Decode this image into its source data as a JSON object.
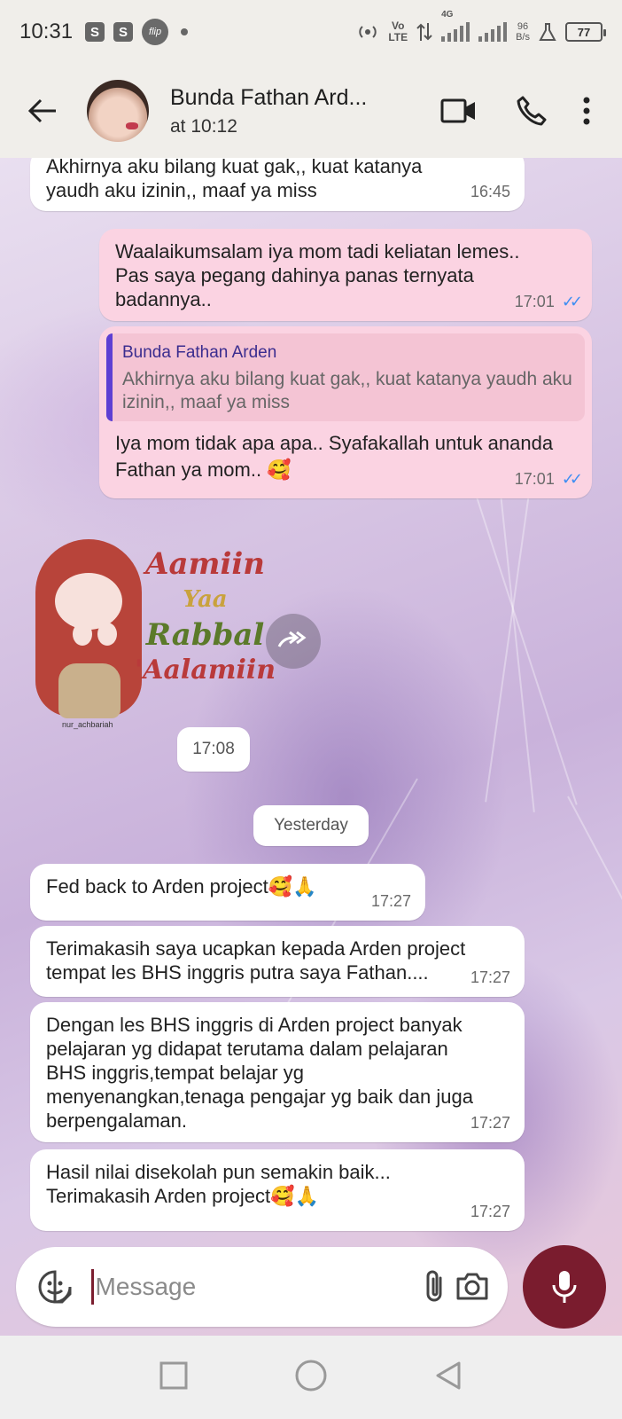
{
  "status_bar": {
    "time": "10:31",
    "flip_label": "flip",
    "network_top": "Vo",
    "network_bottom": "LTE",
    "network_gen": "4G",
    "speed_value": "96",
    "speed_unit": "B/s",
    "battery": "77"
  },
  "header": {
    "contact_name": "Bunda Fathan Ard...",
    "last_seen": "at 10:12"
  },
  "messages": {
    "m1": {
      "text": "Akhirnya aku bilang kuat gak,, kuat katanya yaudh aku izinin,, maaf ya miss",
      "time": "16:45"
    },
    "m2": {
      "text": "Waalaikumsalam iya mom tadi keliatan lemes.. Pas saya pegang dahinya panas ternyata badannya..",
      "time": "17:01"
    },
    "m3": {
      "quote_name": "Bunda Fathan Arden",
      "quote_text": "Akhirnya aku bilang kuat gak,, kuat katanya yaudh aku izinin,, maaf ya miss",
      "text": "Iya mom tidak apa apa.. Syafakallah untuk ananda Fathan ya mom.. 🥰",
      "time": "17:01"
    },
    "sticker": {
      "line1": "Aamiin",
      "line2": "Yaa",
      "line3": "Rabbal",
      "line4": "'Aalamiin",
      "credit": "nur_achbariah",
      "time": "17:08"
    },
    "date_divider": "Yesterday",
    "m4": {
      "text": "Fed back to Arden project🥰🙏",
      "time": "17:27"
    },
    "m5": {
      "text": "Terimakasih saya ucapkan kepada Arden project tempat les BHS inggris putra saya Fathan....",
      "time": "17:27"
    },
    "m6": {
      "text": "Dengan les BHS inggris di Arden project banyak pelajaran yg didapat terutama dalam pelajaran BHS inggris,tempat belajar yg menyenangkan,tenaga pengajar yg baik dan juga berpengalaman.",
      "time": "17:27"
    },
    "m7": {
      "text": "Hasil nilai disekolah pun semakin baik... Terimakasih Arden project🥰🙏",
      "time": "17:27"
    }
  },
  "composer": {
    "placeholder": "Message"
  },
  "colors": {
    "outgoing_bubble": "#fbd3e2",
    "incoming_bubble": "#ffffff",
    "mic_button": "#7a1c2e",
    "read_ticks": "#3e8ef2"
  }
}
